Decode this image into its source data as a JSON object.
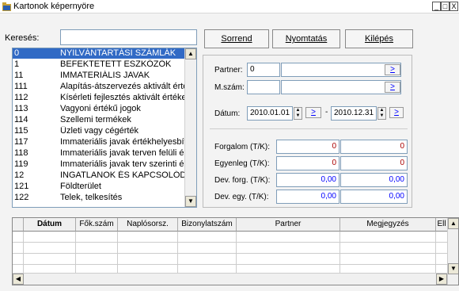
{
  "window": {
    "title": "Kartonok képernyöre",
    "min_label": "_",
    "max_label": "□",
    "close_label": "X"
  },
  "search": {
    "label": "Keresés:",
    "value": ""
  },
  "buttons": {
    "sort": "Sorrend",
    "print": "Nyomtatás",
    "exit": "Kilépés"
  },
  "accounts": [
    {
      "code": "0",
      "name": "NYILVÁNTARTÁSI SZÁMLÁK",
      "selected": true
    },
    {
      "code": "1",
      "name": "BEFEKTETETT ESZKÖZÖK"
    },
    {
      "code": "11",
      "name": "IMMATERIÁLIS JAVAK"
    },
    {
      "code": "111",
      "name": "Alapítás-átszervezés aktivált érték"
    },
    {
      "code": "112",
      "name": "Kísérleti fejlesztés aktivált értéke"
    },
    {
      "code": "113",
      "name": "Vagyoni értékű jogok"
    },
    {
      "code": "114",
      "name": "Szellemi termékek"
    },
    {
      "code": "115",
      "name": "Üzleti vagy cégérték"
    },
    {
      "code": "117",
      "name": "Immateriális javak értékhelyesbíté"
    },
    {
      "code": "118",
      "name": "Immateriális javak terven felüli ért"
    },
    {
      "code": "119",
      "name": "Immateriális javak terv szerinti érte"
    },
    {
      "code": "12",
      "name": "INGATLANOK ÉS KAPCSOLÓDÓ"
    },
    {
      "code": "121",
      "name": "Földterület"
    },
    {
      "code": "122",
      "name": "Telek, telkesítés"
    }
  ],
  "form": {
    "partner_label": "Partner:",
    "partner_value": "0",
    "partner_name": "",
    "mszam_label": "M.szám:",
    "mszam_value": "",
    "mszam_name": "",
    "datum_label": "Dátum:",
    "date_from": "2010.01.01",
    "date_sep": "-",
    "date_to": "2010.12.31",
    "link_label": ">",
    "forgalom_label": "Forgalom (T/K):",
    "forgalom_t": "0",
    "forgalom_k": "0",
    "egyenleg_label": "Egyenleg (T/K):",
    "egyenleg_t": "0",
    "egyenleg_k": "0",
    "devforg_label": "Dev. forg. (T/K):",
    "devforg_t": "0,00",
    "devforg_k": "0,00",
    "devegy_label": "Dev. egy. (T/K):",
    "devegy_t": "0,00",
    "devegy_k": "0,00"
  },
  "grid": {
    "columns": [
      "Dátum",
      "Fők.szám",
      "Naplósorsz.",
      "Bizonylatszám",
      "Partner",
      "Megjegyzés",
      "Ell"
    ]
  },
  "icons": {
    "app": "folder-icon",
    "up": "up-arrow-icon",
    "down": "down-arrow-icon",
    "left": "left-arrow-icon",
    "right": "right-arrow-icon"
  }
}
